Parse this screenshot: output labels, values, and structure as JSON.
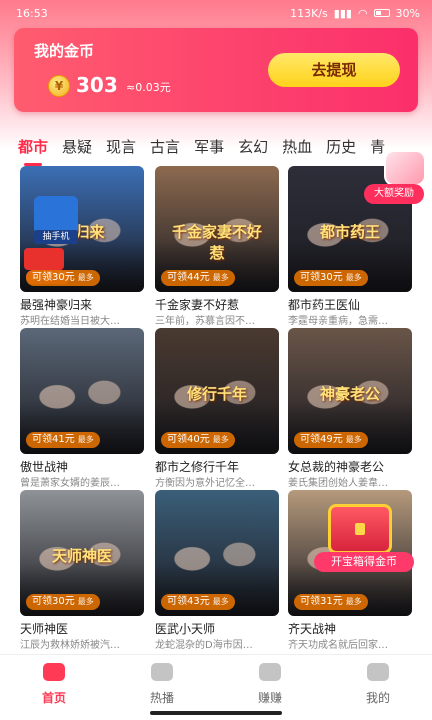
{
  "status_bar": {
    "time": "16:53",
    "network": "113K/s",
    "battery": "30%"
  },
  "coin_card": {
    "title": "我的金币",
    "coin_symbol": "¥",
    "coins": "303",
    "approx": "≈0.03元",
    "withdraw_label": "去提现"
  },
  "tabs": [
    "都市",
    "悬疑",
    "现言",
    "古言",
    "军事",
    "玄幻",
    "热血",
    "历史",
    "青"
  ],
  "active_tab_index": 0,
  "float_bonus": {
    "label": "大额奖励"
  },
  "accent_color": "#ff2d4b",
  "dramas": [
    {
      "title": "最强神豪归来",
      "desc": "苏明在结婚当日被大…",
      "reward": "可领30元",
      "more": "最多",
      "cap": "豪归来",
      "theme": "#3c6fb5",
      "extra_phone": "抽手机",
      "extra_redpack": "百元红包"
    },
    {
      "title": "千金家妻不好惹",
      "desc": "三年前，苏慕言因不…",
      "reward": "可领44元",
      "more": "最多",
      "cap": "千金家妻不好惹",
      "theme": "#8c6a4f"
    },
    {
      "title": "都市药王医仙",
      "desc": "李霆母亲重病，急需…",
      "reward": "可领30元",
      "more": "最多",
      "cap": "都市药王",
      "theme": "#2e2e3a"
    },
    {
      "title": "傲世战神",
      "desc": "曾是萧家女婿的姜辰…",
      "reward": "可领41元",
      "more": "最多",
      "cap": "",
      "theme": "#5b6878"
    },
    {
      "title": "都市之修行千年",
      "desc": "方衡因为意外记忆全…",
      "reward": "可领40元",
      "more": "最多",
      "cap": "修行千年",
      "theme": "#4a3a30"
    },
    {
      "title": "女总裁的神豪老公",
      "desc": "姜氏集团创始人姜韋…",
      "reward": "可领49元",
      "more": "最多",
      "cap": "神豪老公",
      "theme": "#6a5548"
    },
    {
      "title": "天师神医",
      "desc": "江辰为救林娇娇被汽…",
      "reward": "可领30元",
      "more": "最多",
      "cap": "天师神医",
      "theme": "#8f9397"
    },
    {
      "title": "医武小天师",
      "desc": "龙蛇混杂的D海市因…",
      "reward": "可领43元",
      "more": "最多",
      "cap": "",
      "theme": "#3b5f7a"
    },
    {
      "title": "齐天战神",
      "desc": "齐天功成名就后回家…",
      "reward": "可领31元",
      "more": "最多",
      "cap": "",
      "theme": "#b59a7c",
      "chest_label": "开宝箱得金币"
    }
  ],
  "bottom_nav": [
    {
      "label": "首页",
      "icon": "video-home-icon"
    },
    {
      "label": "热播",
      "icon": "play-icon"
    },
    {
      "label": "赚赚",
      "icon": "coin-icon"
    },
    {
      "label": "我的",
      "icon": "user-icon"
    }
  ],
  "active_nav_index": 0
}
